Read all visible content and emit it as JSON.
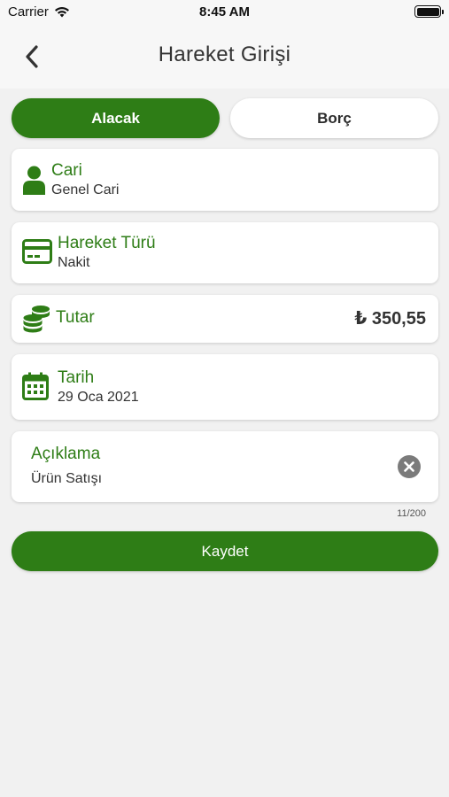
{
  "status_bar": {
    "carrier": "Carrier",
    "time": "8:45 AM"
  },
  "nav": {
    "title": "Hareket Girişi",
    "back_icon": "chevron-left-icon"
  },
  "segments": {
    "active": "Alacak",
    "inactive": "Borç"
  },
  "fields": {
    "cari": {
      "title": "Cari",
      "value": "Genel Cari",
      "icon": "person-icon"
    },
    "hareket_turu": {
      "title": "Hareket Türü",
      "value": "Nakit",
      "icon": "credit-card-icon"
    },
    "tutar": {
      "title": "Tutar",
      "value": "₺ 350,55",
      "icon": "coins-icon"
    },
    "tarih": {
      "title": "Tarih",
      "value": "29 Oca 2021",
      "icon": "calendar-icon"
    }
  },
  "description": {
    "label": "Açıklama",
    "value": "Ürün Satışı",
    "counter": "11/200",
    "clear_icon": "clear-icon"
  },
  "actions": {
    "save_label": "Kaydet"
  },
  "colors": {
    "accent": "#2e7d16",
    "background": "#f1f1f1",
    "card": "#ffffff",
    "clear": "#7b7b7b"
  }
}
